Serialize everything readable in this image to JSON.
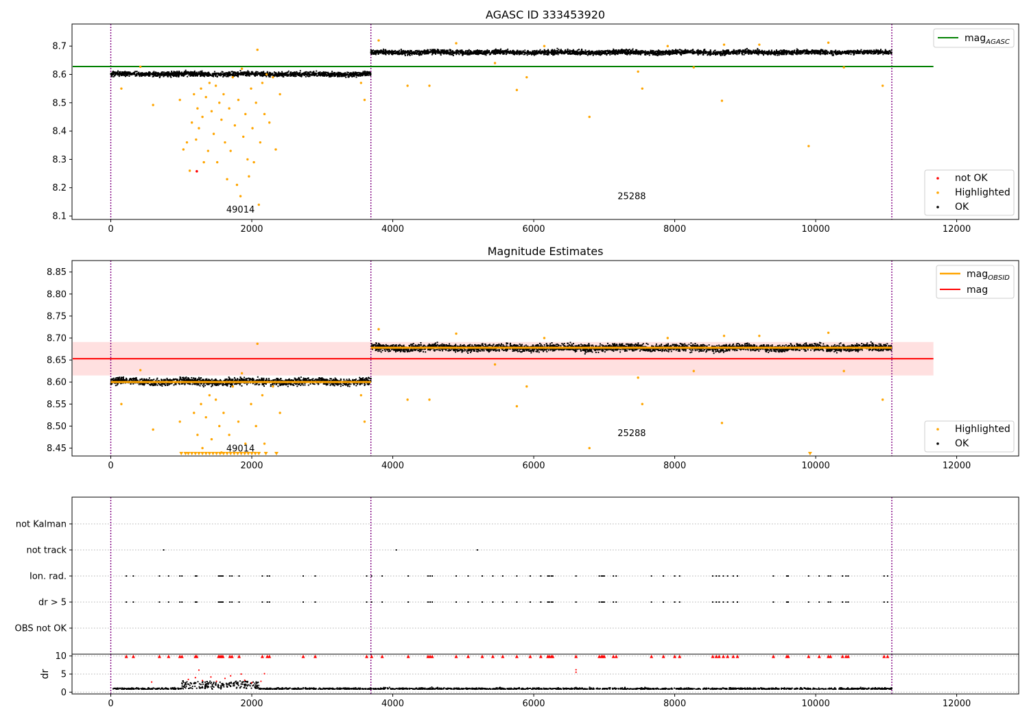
{
  "chart_data": [
    {
      "type": "scatter",
      "title": "AGASC ID 333453920",
      "xlim": [
        -550,
        12880
      ],
      "ylim": [
        8.088,
        8.778
      ],
      "xticks": [
        0,
        2000,
        4000,
        6000,
        8000,
        10000,
        12000
      ],
      "yticks": [
        8.1,
        8.2,
        8.3,
        8.4,
        8.5,
        8.6,
        8.7
      ],
      "xtick_labels": [
        "0",
        "2000",
        "4000",
        "6000",
        "8000",
        "10000",
        "12000"
      ],
      "ytick_labels": [
        "8.1",
        "8.2",
        "8.3",
        "8.4",
        "8.5",
        "8.6",
        "8.7"
      ],
      "vlines": [
        0,
        3690,
        11080
      ],
      "hline": {
        "name": "mag_AGASC",
        "y": 8.628,
        "x_range": [
          -550,
          11670
        ],
        "color": "#008000"
      },
      "segments": [
        {
          "x_range": [
            0,
            3690
          ],
          "mean": 8.601,
          "spread": 0.008,
          "obsid": "49014"
        },
        {
          "x_range": [
            3690,
            11080
          ],
          "mean": 8.678,
          "spread": 0.008,
          "obsid": "25288"
        }
      ],
      "annotations": [
        {
          "text": "49014",
          "x": 1840,
          "y": 8.112
        },
        {
          "text": "25288",
          "x": 7390,
          "y": 8.16
        }
      ],
      "highlighted_points": [
        [
          150,
          8.55
        ],
        [
          420,
          8.627
        ],
        [
          600,
          8.492
        ],
        [
          980,
          8.51
        ],
        [
          1030,
          8.335
        ],
        [
          1080,
          8.36
        ],
        [
          1120,
          8.26
        ],
        [
          1150,
          8.43
        ],
        [
          1180,
          8.53
        ],
        [
          1210,
          8.37
        ],
        [
          1230,
          8.48
        ],
        [
          1250,
          8.41
        ],
        [
          1280,
          8.55
        ],
        [
          1300,
          8.45
        ],
        [
          1320,
          8.29
        ],
        [
          1350,
          8.52
        ],
        [
          1380,
          8.33
        ],
        [
          1400,
          8.57
        ],
        [
          1430,
          8.47
        ],
        [
          1460,
          8.39
        ],
        [
          1490,
          8.56
        ],
        [
          1510,
          8.29
        ],
        [
          1540,
          8.5
        ],
        [
          1570,
          8.44
        ],
        [
          1600,
          8.53
        ],
        [
          1620,
          8.36
        ],
        [
          1650,
          8.23
        ],
        [
          1680,
          8.48
        ],
        [
          1700,
          8.33
        ],
        [
          1730,
          8.59
        ],
        [
          1760,
          8.42
        ],
        [
          1790,
          8.21
        ],
        [
          1810,
          8.51
        ],
        [
          1840,
          8.17
        ],
        [
          1860,
          8.62
        ],
        [
          1880,
          8.38
        ],
        [
          1910,
          8.46
        ],
        [
          1940,
          8.3
        ],
        [
          1960,
          8.24
        ],
        [
          1990,
          8.55
        ],
        [
          2010,
          8.41
        ],
        [
          2030,
          8.29
        ],
        [
          2060,
          8.5
        ],
        [
          2080,
          8.687
        ],
        [
          2100,
          8.14
        ],
        [
          2120,
          8.36
        ],
        [
          2150,
          8.57
        ],
        [
          2180,
          8.46
        ],
        [
          2210,
          8.6
        ],
        [
          2250,
          8.43
        ],
        [
          2300,
          8.59
        ],
        [
          2340,
          8.335
        ],
        [
          2400,
          8.53
        ],
        [
          3550,
          8.57
        ],
        [
          3600,
          8.51
        ],
        [
          3800,
          8.72
        ],
        [
          4210,
          8.56
        ],
        [
          4520,
          8.56
        ],
        [
          4900,
          8.71
        ],
        [
          5450,
          8.64
        ],
        [
          5760,
          8.545
        ],
        [
          5900,
          8.59
        ],
        [
          6150,
          8.7
        ],
        [
          6790,
          8.45
        ],
        [
          7480,
          8.61
        ],
        [
          7540,
          8.55
        ],
        [
          7900,
          8.7
        ],
        [
          8270,
          8.625
        ],
        [
          8670,
          8.507
        ],
        [
          8700,
          8.705
        ],
        [
          9200,
          8.705
        ],
        [
          9900,
          8.347
        ],
        [
          10180,
          8.712
        ],
        [
          10400,
          8.625
        ],
        [
          10950,
          8.56
        ]
      ],
      "not_ok_points": [
        [
          1220,
          8.258
        ]
      ],
      "legends": [
        {
          "entries": [
            "mag_AGASC"
          ]
        },
        {
          "entries": [
            "not OK",
            "Highlighted",
            "OK"
          ]
        }
      ]
    },
    {
      "type": "scatter",
      "title": "Magnitude Estimates",
      "xlim": [
        -550,
        12880
      ],
      "ylim": [
        8.432,
        8.876
      ],
      "xticks": [
        0,
        2000,
        4000,
        6000,
        8000,
        10000,
        12000
      ],
      "yticks": [
        8.45,
        8.5,
        8.55,
        8.6,
        8.65,
        8.7,
        8.75,
        8.8,
        8.85
      ],
      "xtick_labels": [
        "0",
        "2000",
        "4000",
        "6000",
        "8000",
        "10000",
        "12000"
      ],
      "ytick_labels": [
        "8.45",
        "8.50",
        "8.55",
        "8.60",
        "8.65",
        "8.70",
        "8.75",
        "8.80",
        "8.85"
      ],
      "vlines": [
        0,
        3690,
        11080
      ],
      "mag": {
        "name": "mag",
        "y": 8.653,
        "band": [
          8.615,
          8.691
        ],
        "x_range": [
          -550,
          11670
        ],
        "color": "#ff0000"
      },
      "mag_obsid": [
        {
          "x_range": [
            0,
            3690
          ],
          "y": 8.6
        },
        {
          "x_range": [
            3690,
            11080
          ],
          "y": 8.678
        }
      ],
      "segments": [
        {
          "x_range": [
            0,
            3690
          ],
          "mean": 8.601,
          "spread": 0.008,
          "obsid": "49014"
        },
        {
          "x_range": [
            3690,
            11080
          ],
          "mean": 8.678,
          "spread": 0.008,
          "obsid": "25288"
        }
      ],
      "annotations": [
        {
          "text": "49014",
          "x": 1840,
          "y": 8.442
        },
        {
          "text": "25288",
          "x": 7390,
          "y": 8.477
        }
      ],
      "clipped_low_x": [
        1000,
        1060,
        1100,
        1150,
        1200,
        1250,
        1300,
        1350,
        1400,
        1450,
        1500,
        1550,
        1600,
        1650,
        1700,
        1750,
        1800,
        1850,
        1900,
        1950,
        2000,
        2050,
        2100,
        2200,
        2350,
        9920
      ],
      "legends": [
        {
          "entries": [
            "mag_OBSID",
            "mag"
          ]
        },
        {
          "entries": [
            "Highlighted",
            "OK"
          ]
        }
      ]
    },
    {
      "type": "scatter",
      "title": "",
      "xlim": [
        -550,
        12880
      ],
      "categories": [
        "OBS not OK",
        "dr > 5",
        "Ion. rad.",
        "not track",
        "not Kalman"
      ],
      "vlines": [
        0,
        3690,
        11080
      ],
      "flag_times": [
        220,
        320,
        690,
        820,
        980,
        1010,
        1200,
        1220,
        1530,
        1550,
        1570,
        1590,
        1690,
        1720,
        1820,
        2150,
        2220,
        2250,
        2730,
        2900,
        3630,
        3700,
        3850,
        4220,
        4500,
        4530,
        4560,
        4900,
        5070,
        5270,
        5420,
        5560,
        5760,
        5950,
        6100,
        6200,
        6220,
        6250,
        6270,
        6600,
        6930,
        6960,
        6980,
        7000,
        7130,
        7170,
        7670,
        7840,
        8000,
        8070,
        8540,
        8590,
        8630,
        8690,
        8750,
        8830,
        8890,
        9400,
        9590,
        9610,
        9900,
        10050,
        10180,
        10210,
        10380,
        10430,
        10460,
        10970,
        11020
      ],
      "not_track_times": [
        750,
        4050,
        5200
      ]
    },
    {
      "type": "scatter",
      "title": "",
      "ylabel": "dr",
      "xlim": [
        -550,
        12880
      ],
      "ylim": [
        -0.5,
        10.5
      ],
      "yticks": [
        0,
        5,
        10
      ],
      "ytick_labels": [
        "0",
        "5",
        "10"
      ],
      "xticks": [
        0,
        2000,
        4000,
        6000,
        8000,
        10000,
        12000
      ],
      "xtick_labels": [
        "0",
        "2000",
        "4000",
        "6000",
        "8000",
        "10000",
        "12000"
      ],
      "vlines": [
        0,
        3690,
        11080
      ],
      "dr_baseline": 0.8,
      "dr_bump": {
        "x_range": [
          1000,
          2100
        ],
        "max": 2.0
      },
      "dr_elevated_points": [
        [
          580,
          2.8
        ],
        [
          1100,
          3.5
        ],
        [
          1200,
          4.0
        ],
        [
          1250,
          6.1
        ],
        [
          1300,
          3.2
        ],
        [
          1420,
          4.2
        ],
        [
          1500,
          3.0
        ],
        [
          1620,
          3.8
        ],
        [
          1700,
          4.5
        ],
        [
          1850,
          5.0
        ],
        [
          1900,
          3.3
        ],
        [
          2000,
          2.6
        ],
        [
          2130,
          3.0
        ],
        [
          2180,
          5.1
        ],
        [
          6600,
          6.2
        ],
        [
          6600,
          5.5
        ]
      ]
    }
  ]
}
